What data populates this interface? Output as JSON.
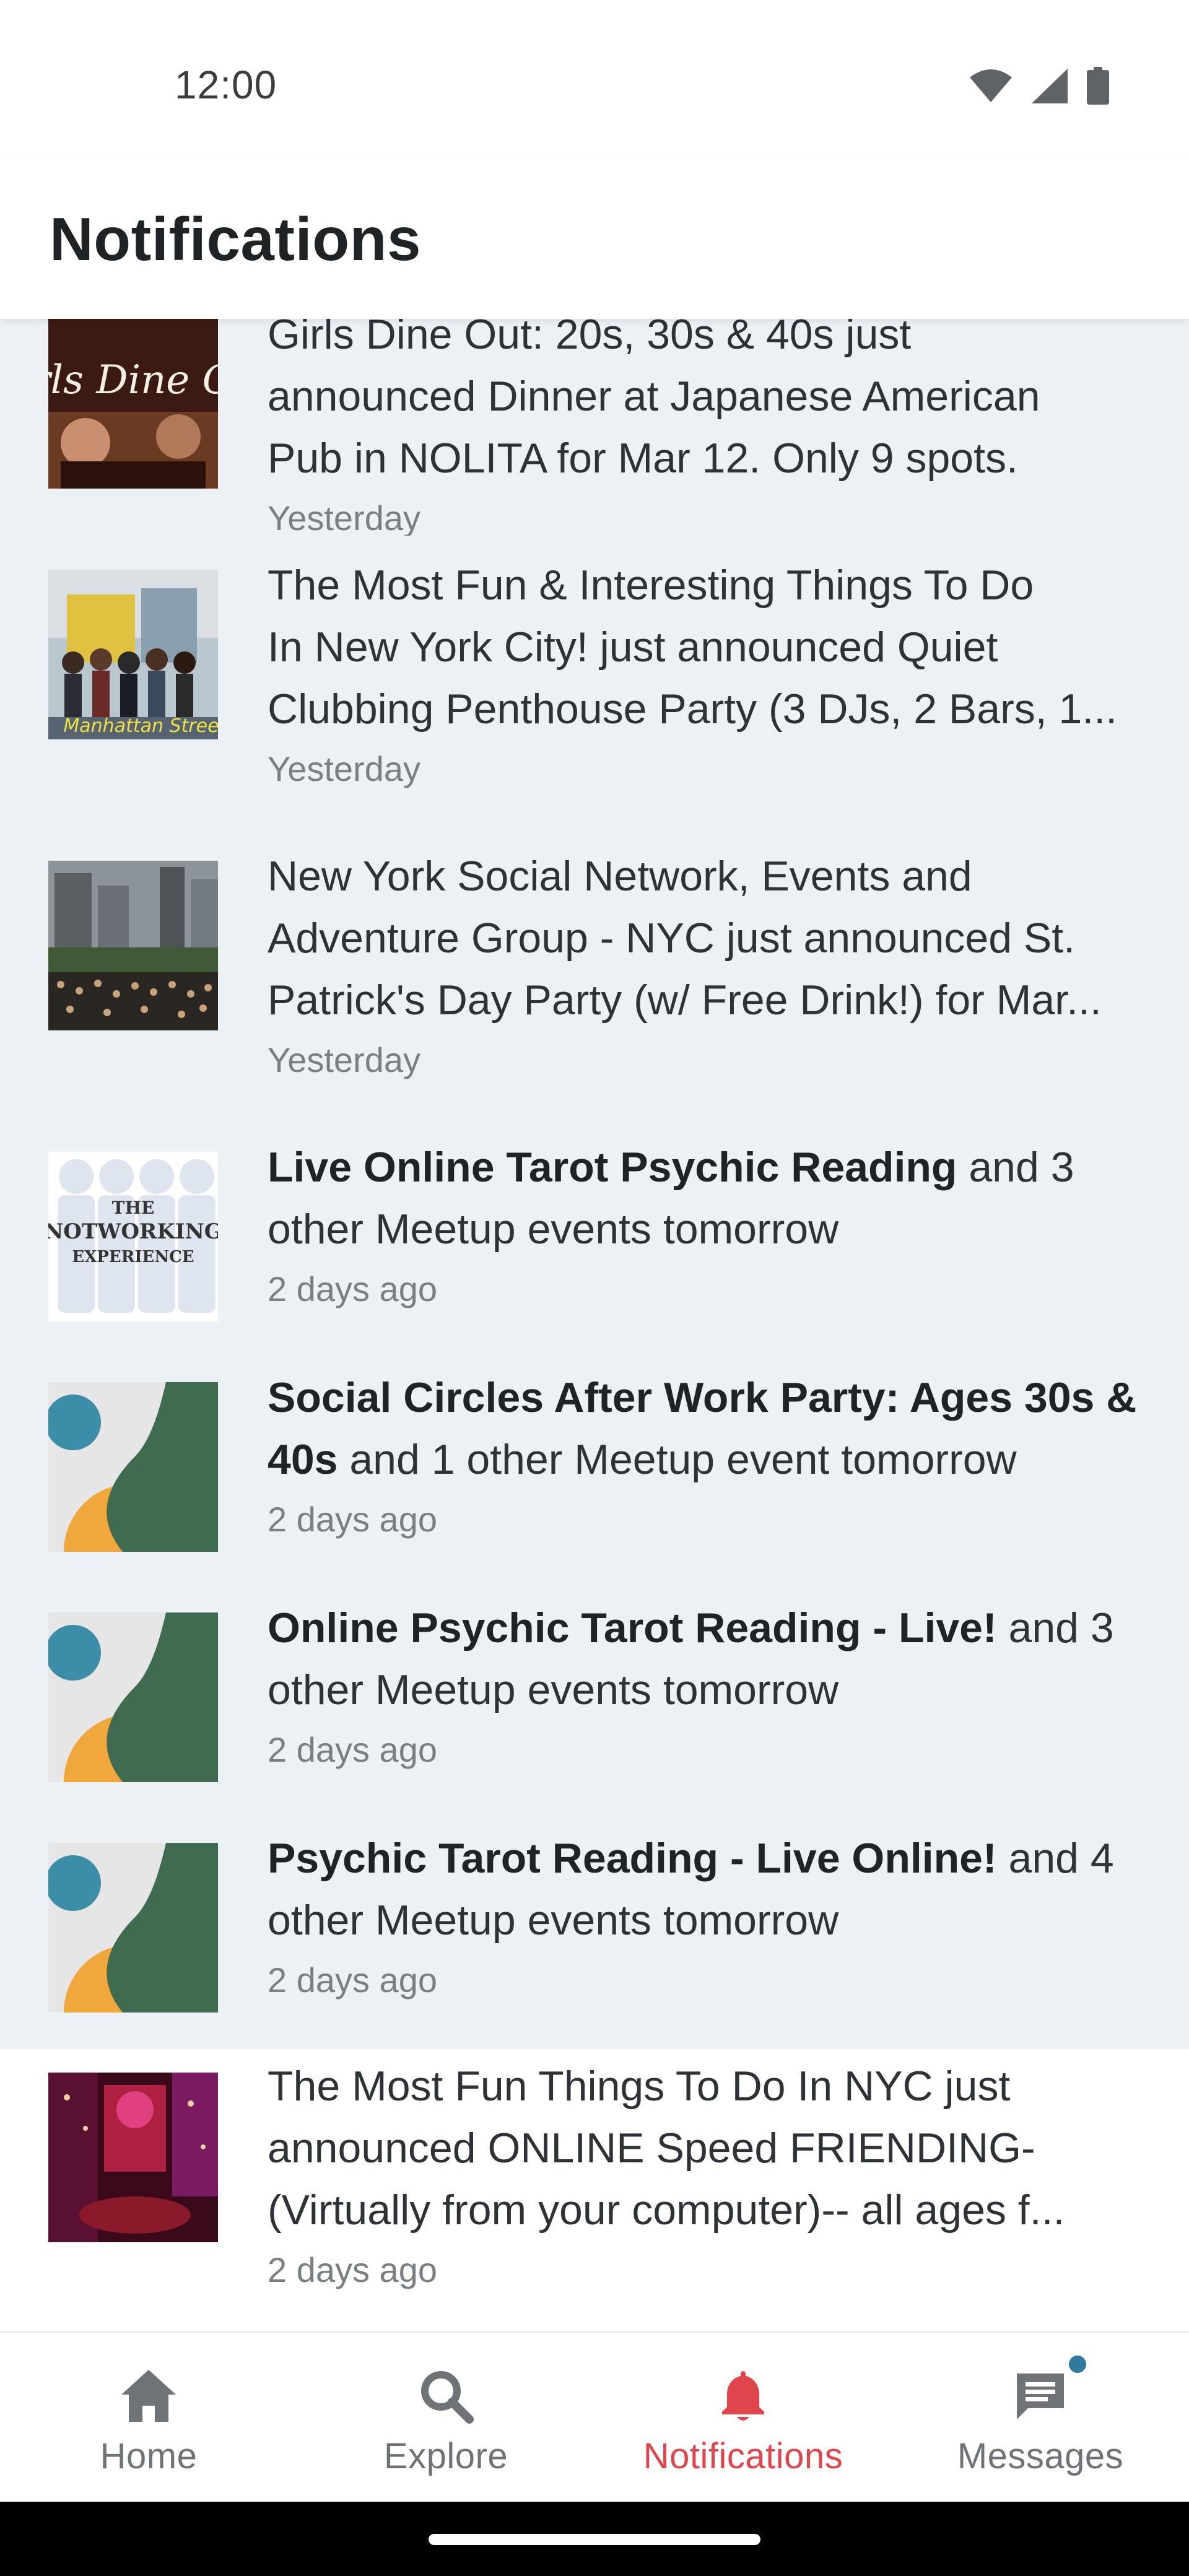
{
  "status_bar": {
    "time": "12:00",
    "icons": [
      "wifi-icon",
      "cellular-signal-icon",
      "battery-icon"
    ]
  },
  "header": {
    "title": "Notifications"
  },
  "notifications": [
    {
      "thumbnail": "girls-dine-out-photo",
      "lines": [
        {
          "bold": "",
          "text": "Girls Dine Out: 20s, 30s & 40s just"
        },
        {
          "bold": "",
          "text": "announced Dinner at Japanese American"
        },
        {
          "bold": "",
          "text": "Pub in NOLITA for Mar 12. Only 9 spots."
        }
      ],
      "time": "Yesterday",
      "read": false
    },
    {
      "thumbnail": "group-street-photo",
      "lines": [
        {
          "bold": "",
          "text": "The Most Fun & Interesting Things To Do"
        },
        {
          "bold": "",
          "text": "In New York City! just announced Quiet"
        },
        {
          "bold": "",
          "text": "Clubbing Penthouse Party (3 DJs, 2 Bars, 1..."
        }
      ],
      "time": "Yesterday",
      "read": false
    },
    {
      "thumbnail": "park-crowd-photo",
      "lines": [
        {
          "bold": "",
          "text": "New York Social Network, Events and"
        },
        {
          "bold": "",
          "text": "Adventure Group - NYC just announced St."
        },
        {
          "bold": "",
          "text": "Patrick's Day Party (w/ Free Drink!) for Mar..."
        }
      ],
      "time": "Yesterday",
      "read": false
    },
    {
      "thumbnail": "notworking-experience-logo",
      "thumbnail_text": [
        "THE",
        "NOTWORKING",
        "EXPERIENCE"
      ],
      "lines": [
        {
          "bold": "Live Online Tarot Psychic Reading",
          "text": " and 3"
        },
        {
          "bold": "",
          "text": "other Meetup events tomorrow"
        }
      ],
      "time": "2 days ago",
      "read": false
    },
    {
      "thumbnail": "meetup-default-graphic",
      "lines": [
        {
          "bold": "Social Circles After Work Party: Ages 30s &",
          "text": ""
        },
        {
          "bold": "40s",
          "text": " and 1 other Meetup event tomorrow"
        }
      ],
      "time": "2 days ago",
      "read": false
    },
    {
      "thumbnail": "meetup-default-graphic",
      "lines": [
        {
          "bold": "Online Psychic Tarot Reading - Live!",
          "text": " and 3"
        },
        {
          "bold": "",
          "text": "other Meetup events tomorrow"
        }
      ],
      "time": "2 days ago",
      "read": false
    },
    {
      "thumbnail": "meetup-default-graphic",
      "lines": [
        {
          "bold": "Psychic Tarot Reading - Live Online!",
          "text": " and 4"
        },
        {
          "bold": "",
          "text": "other Meetup events tomorrow"
        }
      ],
      "time": "2 days ago",
      "read": false
    },
    {
      "thumbnail": "penthouse-party-photo",
      "lines": [
        {
          "bold": "",
          "text": "The Most Fun Things To Do In NYC just"
        },
        {
          "bold": "",
          "text": "announced ONLINE Speed FRIENDING-"
        },
        {
          "bold": "",
          "text": "(Virtually from your computer)-- all ages f..."
        }
      ],
      "time": "2 days ago",
      "read": true
    }
  ],
  "bottom_nav": {
    "items": [
      {
        "label": "Home",
        "icon": "home-icon",
        "active": false
      },
      {
        "label": "Explore",
        "icon": "search-icon",
        "active": false
      },
      {
        "label": "Notifications",
        "icon": "bell-icon",
        "active": true
      },
      {
        "label": "Messages",
        "icon": "chat-icon",
        "active": false,
        "badge": true
      }
    ]
  },
  "colors": {
    "unread_background": "#ebf1f4",
    "read_background": "#ffffff",
    "active_tab": "#e0454b",
    "inactive_tab": "#6f7377",
    "badge": "#2f7a9f"
  }
}
